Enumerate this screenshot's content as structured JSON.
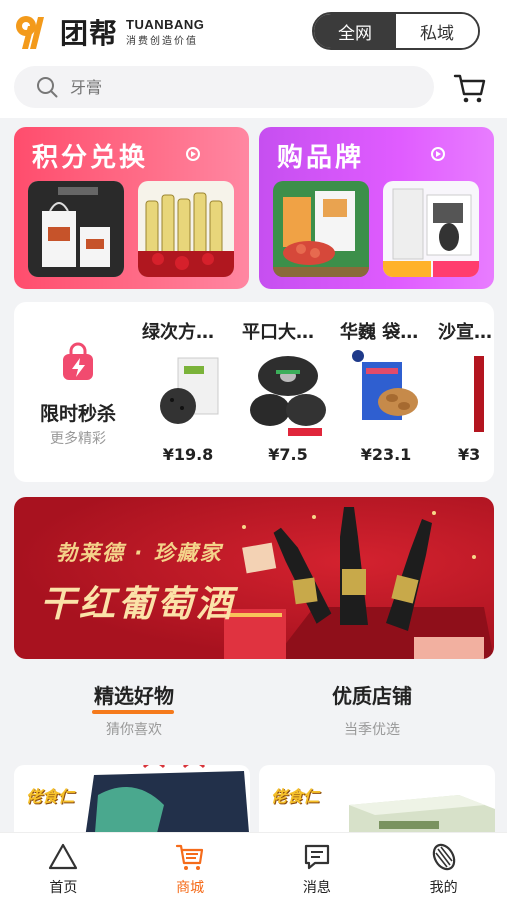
{
  "header": {
    "logo_mark": "9",
    "logo_cn": "团帮",
    "logo_en": "TUANBANG",
    "logo_sub": "消费创造价值",
    "segments": [
      {
        "label": "全网",
        "active": true
      },
      {
        "label": "私域",
        "active": false
      }
    ]
  },
  "search": {
    "placeholder": "牙膏",
    "icon": "search-icon"
  },
  "promos": [
    {
      "title": "积分兑换",
      "color": "#ff5a78"
    },
    {
      "title": "购品牌",
      "color": "#d457f5"
    }
  ],
  "flash_sale": {
    "title": "限时秒杀",
    "subtitle": "更多精彩",
    "items": [
      {
        "name": "绿次方…",
        "price": "¥19.8"
      },
      {
        "name": "平口大…",
        "price": "¥7.5"
      },
      {
        "name": "华巍 袋…",
        "price": "¥23.1"
      },
      {
        "name": "沙宣…",
        "price": "¥3"
      }
    ]
  },
  "banner": {
    "line1": "勃莱德 · 珍藏家",
    "line2": "干红葡萄酒"
  },
  "tabs": [
    {
      "title": "精选好物",
      "subtitle": "猜你喜欢",
      "active": true
    },
    {
      "title": "优质店铺",
      "subtitle": "当季优选",
      "active": false
    }
  ],
  "cards": [
    {
      "brand": "佬食仁"
    },
    {
      "brand": "佬食仁"
    }
  ],
  "nav": [
    {
      "label": "首页",
      "icon": "home-triangle-icon",
      "active": false
    },
    {
      "label": "商城",
      "icon": "shopping-cart-icon",
      "active": true
    },
    {
      "label": "消息",
      "icon": "message-icon",
      "active": false
    },
    {
      "label": "我的",
      "icon": "seed-icon",
      "active": false
    }
  ],
  "colors": {
    "accent": "#f56b1a",
    "logo_orange": "#f39a1b",
    "segment_dark": "#3b3b3b"
  }
}
